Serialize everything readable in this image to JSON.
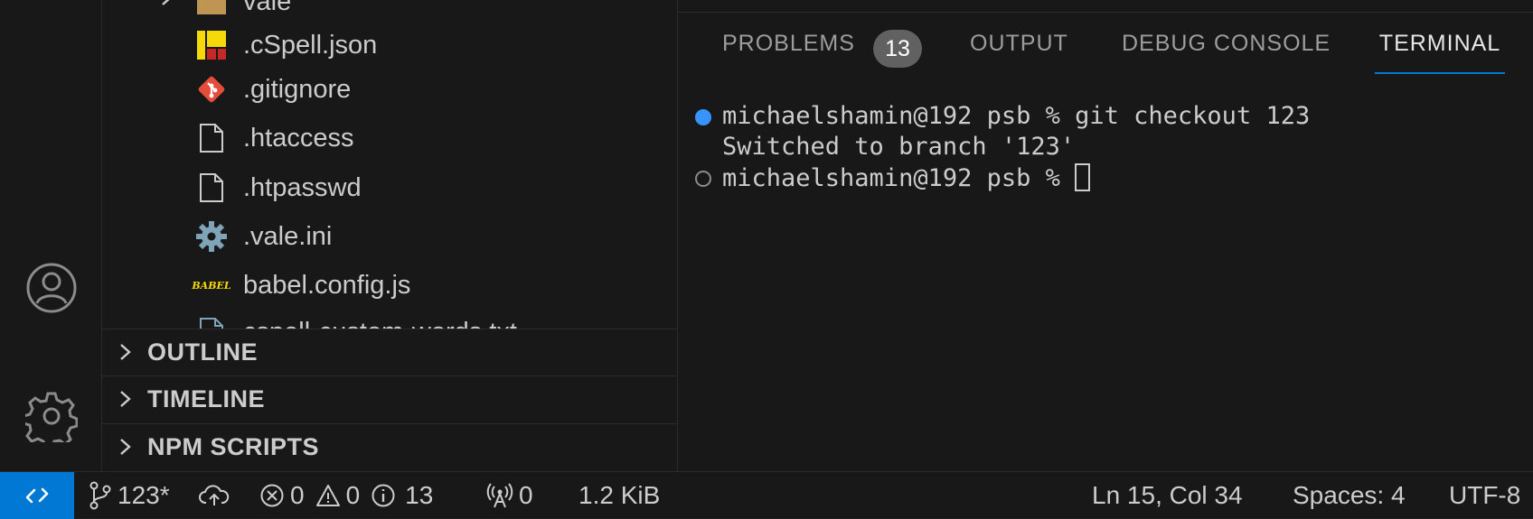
{
  "explorer": {
    "files": [
      {
        "name": "vale",
        "icon": "folder-icon"
      },
      {
        "name": ".cSpell.json",
        "icon": "cspell-icon"
      },
      {
        "name": ".gitignore",
        "icon": "git-icon"
      },
      {
        "name": ".htaccess",
        "icon": "file-icon"
      },
      {
        "name": ".htpasswd",
        "icon": "file-icon"
      },
      {
        "name": ".vale.ini",
        "icon": "gear-icon"
      },
      {
        "name": "babel.config.js",
        "icon": "babel-icon"
      },
      {
        "name": "cspell-custom-words.txt",
        "icon": "file-icon"
      }
    ],
    "babel_logo_text": "BABEL"
  },
  "sections": {
    "outline": "OUTLINE",
    "timeline": "TIMELINE",
    "npm_scripts": "NPM SCRIPTS"
  },
  "panel": {
    "tabs": {
      "problems": "PROBLEMS",
      "problems_count": "13",
      "output": "OUTPUT",
      "debug_console": "DEBUG CONSOLE",
      "terminal": "TERMINAL"
    },
    "active_tab": "TERMINAL",
    "terminal": {
      "line1": "michaelshamin@192 psb % git checkout 123",
      "line2": "Switched to branch '123'",
      "prompt": "michaelshamin@192 psb % "
    }
  },
  "statusbar": {
    "branch": "123*",
    "errors": "0",
    "warnings": "0",
    "infos": "13",
    "ports": "0",
    "file_size": "1.2 KiB",
    "cursor_position": "Ln 15, Col 34",
    "indentation": "Spaces: 4",
    "encoding": "UTF-8"
  },
  "colors": {
    "background": "#1f1f1f",
    "panel_background": "#181818",
    "accent": "#0078d4",
    "terminal_decoration_success": "#3794ff",
    "badge": "#616161",
    "git_icon": "#e44d3a",
    "cspell_yellow": "#f5d90a",
    "cspell_red": "#c62828"
  }
}
